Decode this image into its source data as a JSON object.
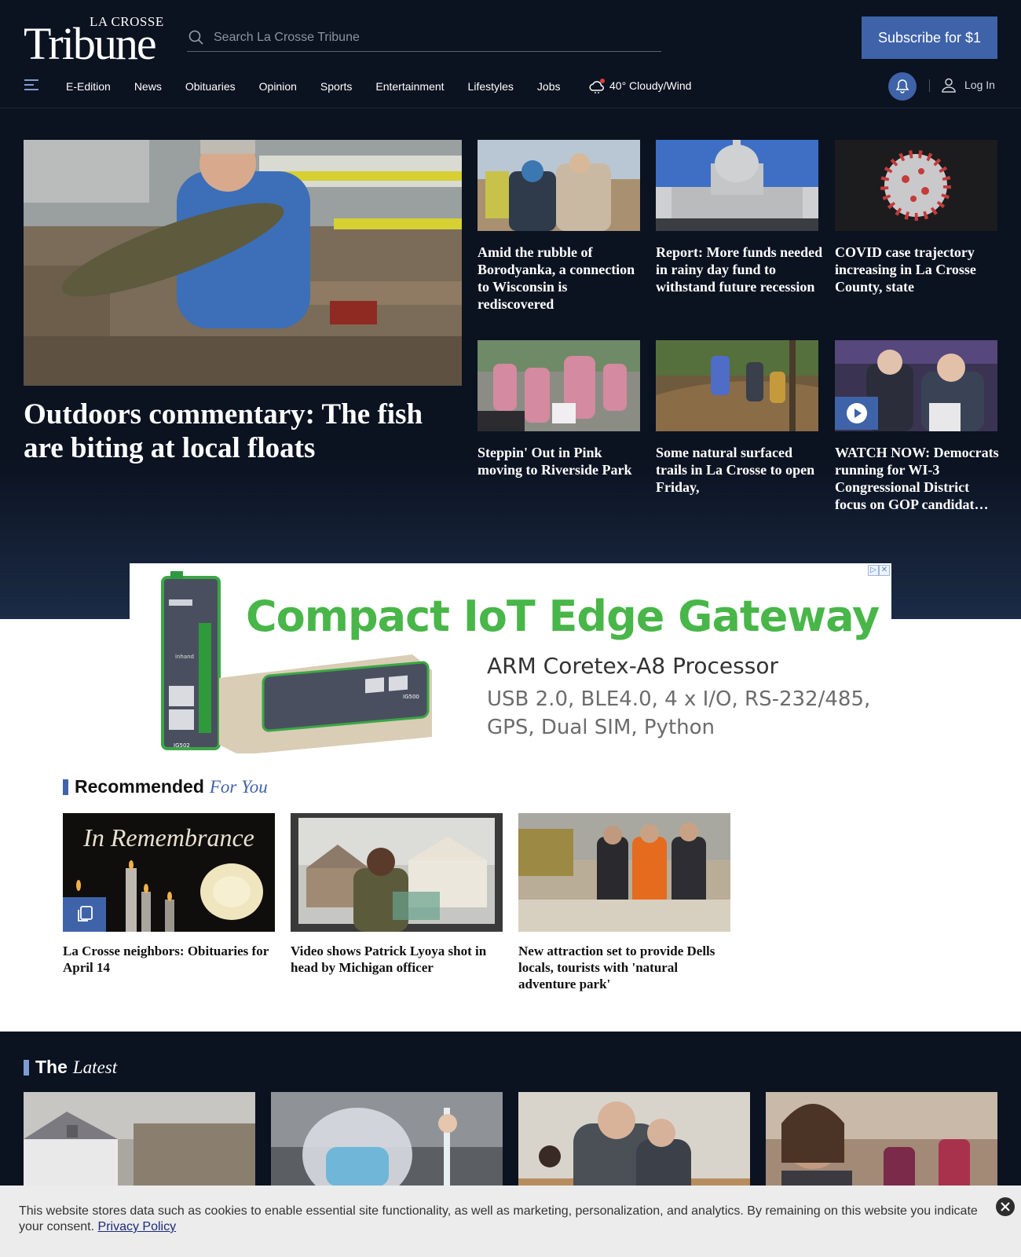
{
  "header": {
    "logo_small": "LA CROSSE",
    "logo_big": "Tribune",
    "search_placeholder": "Search La Crosse Tribune",
    "subscribe_label": "Subscribe for $1"
  },
  "nav": {
    "items": [
      "E-Edition",
      "News",
      "Obituaries",
      "Opinion",
      "Sports",
      "Entertainment",
      "Lifestyles",
      "Jobs"
    ],
    "weather": "40° Cloudy/Wind",
    "login_label": "Log In"
  },
  "hero": {
    "lead_title": "Outdoors commentary: The fish are biting at local floats",
    "cards": [
      {
        "title": "Amid the rubble of Borodyanka, a connection to Wisconsin is rediscovered"
      },
      {
        "title": "Report: More funds needed in rainy day fund to withstand future recession"
      },
      {
        "title": "COVID case trajectory increasing in La Crosse County, state"
      },
      {
        "title": "Steppin' Out in Pink moving to Riverside Park"
      },
      {
        "title": "Some natural surfaced trails in La Crosse to open Friday,"
      },
      {
        "title": "WATCH NOW: Democrats running for WI-3 Congressional District focus on GOP candidat…"
      }
    ]
  },
  "ad": {
    "headline": "Compact IoT Edge Gateway",
    "subhead": "ARM Coretex-A8 Processor",
    "line1": "USB 2.0, BLE4.0, 4 x I/O, RS-232/485,",
    "line2": "GPS, Dual SIM, Python",
    "device_label_1": "IG502",
    "device_label_2": "IG500",
    "brand": "inhand"
  },
  "recommended": {
    "heading": "Recommended",
    "heading_em": "For You",
    "remembrance_text": "In Remembrance",
    "items": [
      {
        "title": "La Crosse neighbors: Obituaries for April 14"
      },
      {
        "title": "Video shows Patrick Lyoya shot in head by Michigan officer"
      },
      {
        "title": "New attraction set to provide Dells locals, tourists with 'natural adventure park'"
      }
    ]
  },
  "latest": {
    "heading": "The",
    "heading_em": "Latest"
  },
  "cookie": {
    "text": "This website stores data such as cookies to enable essential site functionality, as well as marketing, personalization, and analytics. By remaining on this website you indicate your consent.",
    "link": "Privacy Policy"
  },
  "colors": {
    "header_bg": "#0b1220",
    "accent": "#3f63a9",
    "ad_green": "#48b648"
  }
}
